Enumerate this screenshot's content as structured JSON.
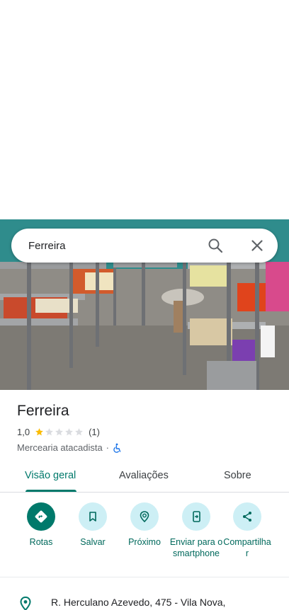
{
  "search": {
    "query": "Ferreira"
  },
  "place": {
    "name": "Ferreira",
    "rating": "1,0",
    "stars_filled": 1,
    "stars_total": 5,
    "review_count": "(1)",
    "category": "Mercearia atacadista",
    "separator": "·"
  },
  "tabs": [
    {
      "label": "Visão geral",
      "active": true
    },
    {
      "label": "Avaliações",
      "active": false
    },
    {
      "label": "Sobre",
      "active": false
    }
  ],
  "actions": [
    {
      "label": "Rotas",
      "icon": "directions-icon"
    },
    {
      "label": "Salvar",
      "icon": "bookmark-icon"
    },
    {
      "label": "Próximo",
      "icon": "nearby-icon"
    },
    {
      "label": "Enviar para o smartphone",
      "icon": "send-to-phone-icon"
    },
    {
      "label": "Compartilhar",
      "icon": "share-icon"
    }
  ],
  "address": {
    "text": "R. Herculano Azevedo, 475 - Vila Nova,"
  },
  "colors": {
    "accent": "#00796b",
    "action_bg": "#cdeff5",
    "star": "#fbbc04",
    "star_empty": "#dadce0",
    "accessibility": "#1a73e8"
  }
}
